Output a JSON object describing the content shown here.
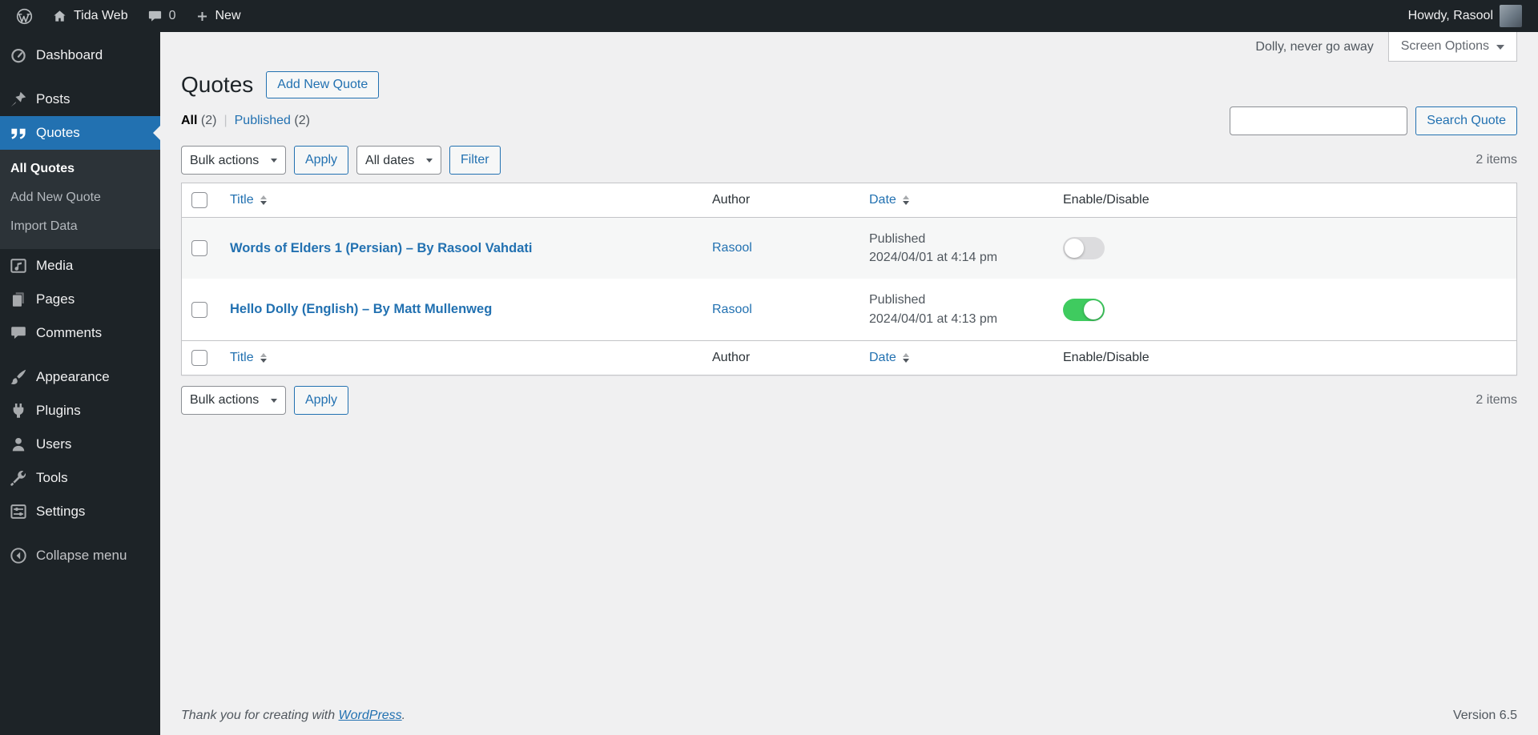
{
  "colors": {
    "accent": "#2271b1",
    "admin_bar_bg": "#1d2327",
    "submenu_bg": "#2c3338",
    "content_bg": "#f0f0f1",
    "toggle_on": "#3fcb5f",
    "toggle_off": "#dcdcde"
  },
  "admin_bar": {
    "site_name": "Tida Web",
    "comments_count": "0",
    "new_label": "New",
    "howdy": "Howdy, Rasool"
  },
  "sidebar": {
    "items": [
      "Dashboard",
      "Posts",
      "Quotes",
      "Media",
      "Pages",
      "Comments",
      "Appearance",
      "Plugins",
      "Users",
      "Tools",
      "Settings"
    ],
    "quotes_submenu": [
      "All Quotes",
      "Add New Quote",
      "Import Data"
    ],
    "collapse_label": "Collapse menu"
  },
  "header": {
    "dolly_text": "Dolly, never go away",
    "screen_options": "Screen Options",
    "page_title": "Quotes",
    "add_new_button": "Add New Quote"
  },
  "filters": {
    "all_label": "All",
    "all_count": "(2)",
    "separator": "|",
    "published_label": "Published",
    "published_count": "(2)",
    "search_button": "Search Quote",
    "bulk_actions": "Bulk actions",
    "apply": "Apply",
    "all_dates": "All dates",
    "filter": "Filter",
    "items_count": "2 items"
  },
  "table": {
    "headers": {
      "title": "Title",
      "author": "Author",
      "date": "Date",
      "enable": "Enable/Disable"
    },
    "rows": [
      {
        "title": "Words of Elders 1 (Persian) – By Rasool Vahdati",
        "author": "Rasool",
        "status": "Published",
        "date": "2024/04/01 at 4:14 pm",
        "enabled": false
      },
      {
        "title": "Hello Dolly (English) – By Matt Mullenweg",
        "author": "Rasool",
        "status": "Published",
        "date": "2024/04/01 at 4:13 pm",
        "enabled": true
      }
    ]
  },
  "footer": {
    "thanks_prefix": "Thank you for creating with ",
    "wordpress_link": "WordPress",
    "thanks_suffix": ".",
    "version": "Version 6.5"
  }
}
